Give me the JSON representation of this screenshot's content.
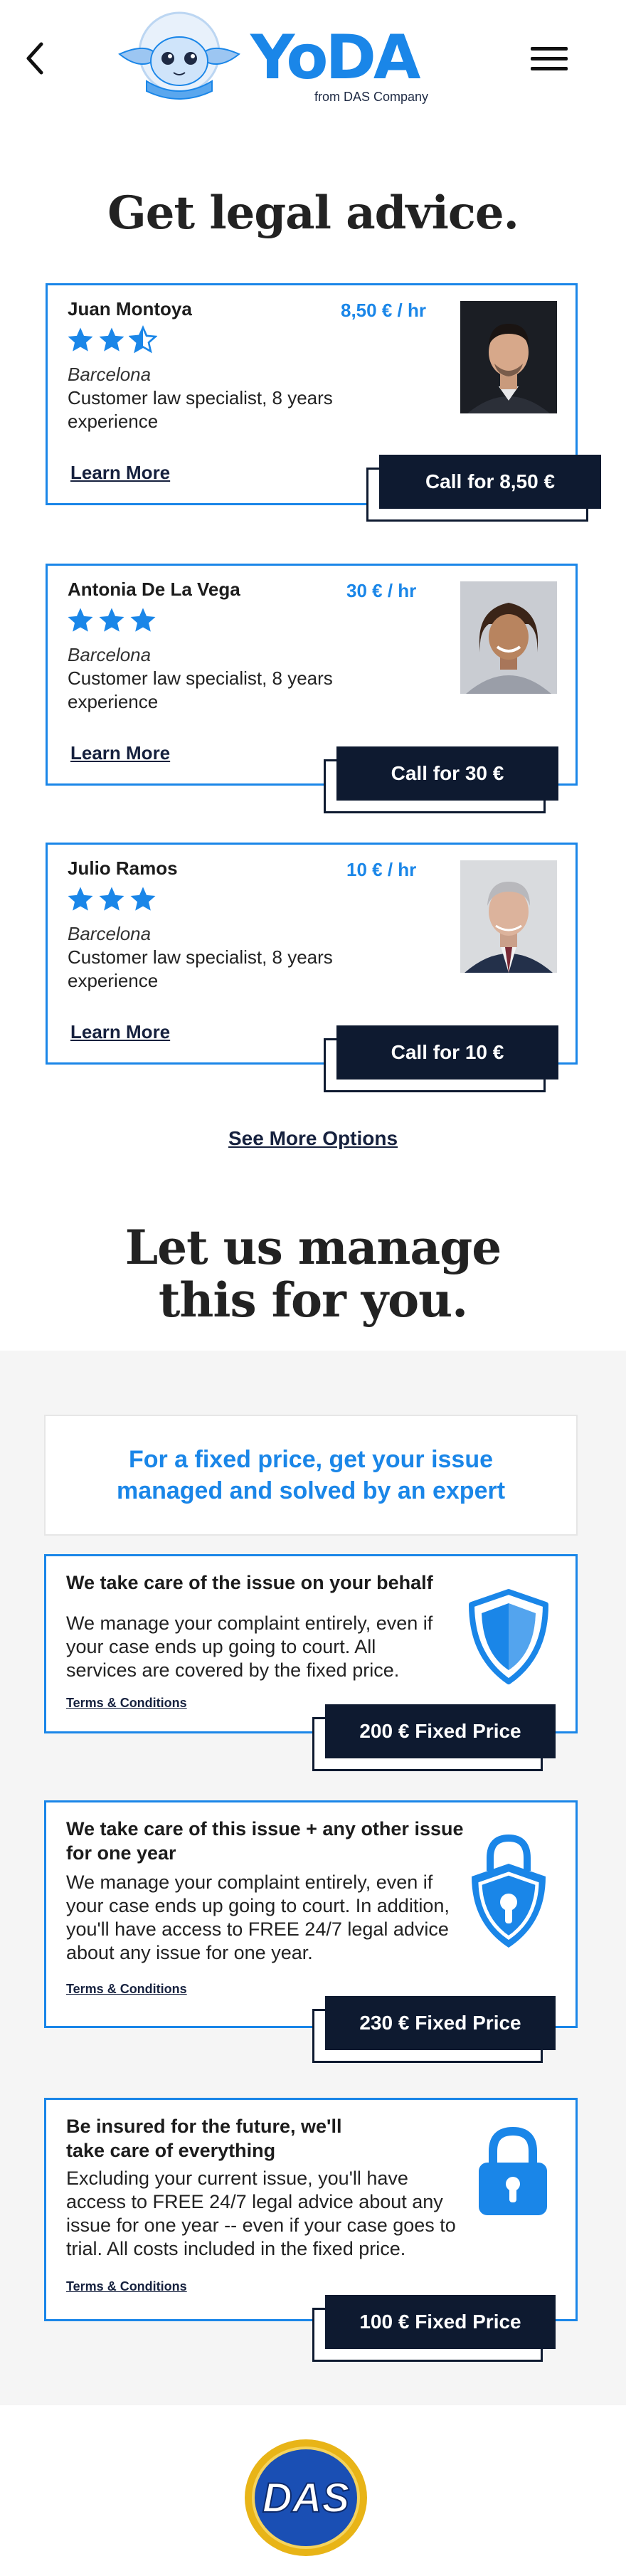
{
  "header": {
    "brand": "YoDA",
    "brand_sub": "from DAS Company"
  },
  "advice": {
    "title": "Get legal advice.",
    "lawyers": [
      {
        "name": "Juan Montoya",
        "rate": "8,50 € / hr",
        "rating": 2.5,
        "city": "Barcelona",
        "desc": "Customer law specialist, 8 years experience",
        "learn_more": "Learn More",
        "cta": "Call for 8,50 €"
      },
      {
        "name": "Antonia De La Vega",
        "rate": "30 € / hr",
        "rating": 3,
        "city": "Barcelona",
        "desc": "Customer law specialist, 8 years experience",
        "learn_more": "Learn More",
        "cta": "Call for 30 €"
      },
      {
        "name": "Julio Ramos",
        "rate": "10 € / hr",
        "rating": 3,
        "city": "Barcelona",
        "desc": "Customer law specialist, 8 years experience",
        "learn_more": "Learn More",
        "cta": "Call for 10 €"
      }
    ],
    "see_more": "See More Options"
  },
  "managed": {
    "title_line1": "Let us manage",
    "title_line2": "this for you.",
    "promo": "For a fixed price, get your issue managed and solved by an expert",
    "plans": [
      {
        "title": "We take care of the issue on your behalf",
        "desc": "We manage your complaint entirely, even if your case ends up going to court. All services are covered by the fixed price.",
        "terms": "Terms & Conditions",
        "cta": "200 € Fixed Price",
        "icon": "shield-icon"
      },
      {
        "title": "We take care of this issue + any other issue for one year",
        "desc": "We manage your complaint entirely, even if your case ends up going to court. In addition, you'll have access to FREE 24/7 legal advice about any issue for one year.",
        "terms": "Terms & Conditions",
        "cta": "230 € Fixed Price",
        "icon": "shield-lock-icon"
      },
      {
        "title": "Be insured for the future, we'll take care of everything",
        "desc": "Excluding your current issue, you'll have access to FREE 24/7 legal advice about any issue for one year -- even if your case goes to trial. All costs included in the fixed price.",
        "terms": "Terms & Conditions",
        "cta": "100 € Fixed Price",
        "icon": "padlock-icon"
      }
    ]
  },
  "footer": {
    "logo_text": "DAS"
  },
  "colors": {
    "accent": "#1a86e8",
    "navy": "#0e1a30",
    "gray_bg": "#f5f5f5",
    "gold": "#e8b417"
  }
}
